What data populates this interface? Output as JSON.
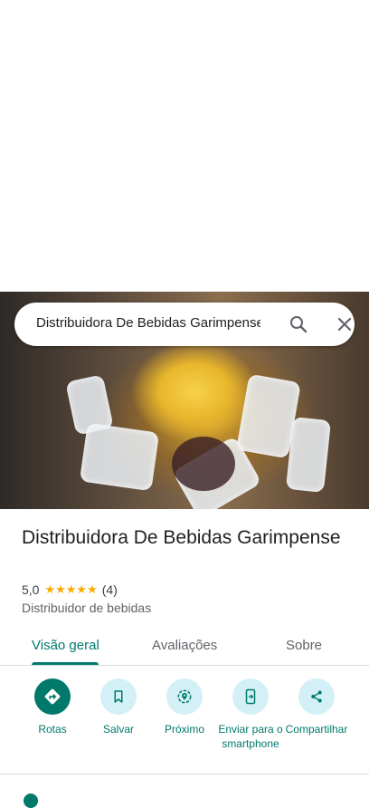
{
  "search": {
    "query": "Distribuidora De Bebidas Garimpense"
  },
  "place": {
    "name": "Distribuidora De Bebidas Garimpense",
    "rating": "5,0",
    "stars": "★★★★★",
    "review_count": "(4)",
    "category": "Distribuidor de bebidas"
  },
  "tabs": [
    {
      "label": "Visão geral",
      "active": true
    },
    {
      "label": "Avaliações",
      "active": false
    },
    {
      "label": "Sobre",
      "active": false
    }
  ],
  "actions": [
    {
      "label": "Rotas",
      "icon": "directions-icon"
    },
    {
      "label": "Salvar",
      "icon": "bookmark-icon"
    },
    {
      "label": "Próximo",
      "icon": "nearby-icon"
    },
    {
      "label": "Enviar para o smartphone",
      "icon": "send-to-phone-icon"
    },
    {
      "label": "Compartilhar",
      "icon": "share-icon"
    }
  ],
  "colors": {
    "accent": "#00796b",
    "action_bg": "#d3f0f7",
    "star": "#f9ab00"
  }
}
